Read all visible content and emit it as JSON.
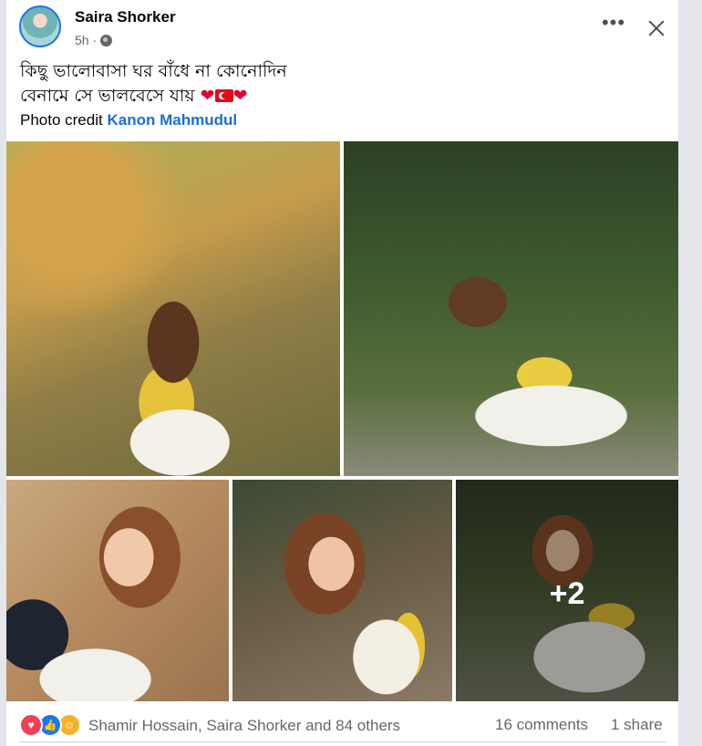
{
  "post": {
    "author": "Saira Shorker",
    "time": "5h",
    "caption_line1": "কিছু ভালোবাসা ঘর বাঁধে না কোনোদিন",
    "caption_line2": "বেনামে সে ভালবেসে যায়",
    "caption_emojis": {
      "heart": "❤",
      "flag": "turkey-flag"
    },
    "credit_label": "Photo credit",
    "credit_name": "Kanon Mahmudul",
    "more_photos_count": "+2",
    "reactions": {
      "icons": [
        "love-reaction",
        "like-reaction",
        "care-reaction"
      ],
      "summary": "Shamir Hossain, Saira Shorker and 84 others"
    },
    "comments": "16 comments",
    "shares": "1 share"
  },
  "colors": {
    "link": "#1b6fd6",
    "secondary_text": "#65676b",
    "love": "#f33e58",
    "like": "#1877f2",
    "care": "#f7b125"
  }
}
